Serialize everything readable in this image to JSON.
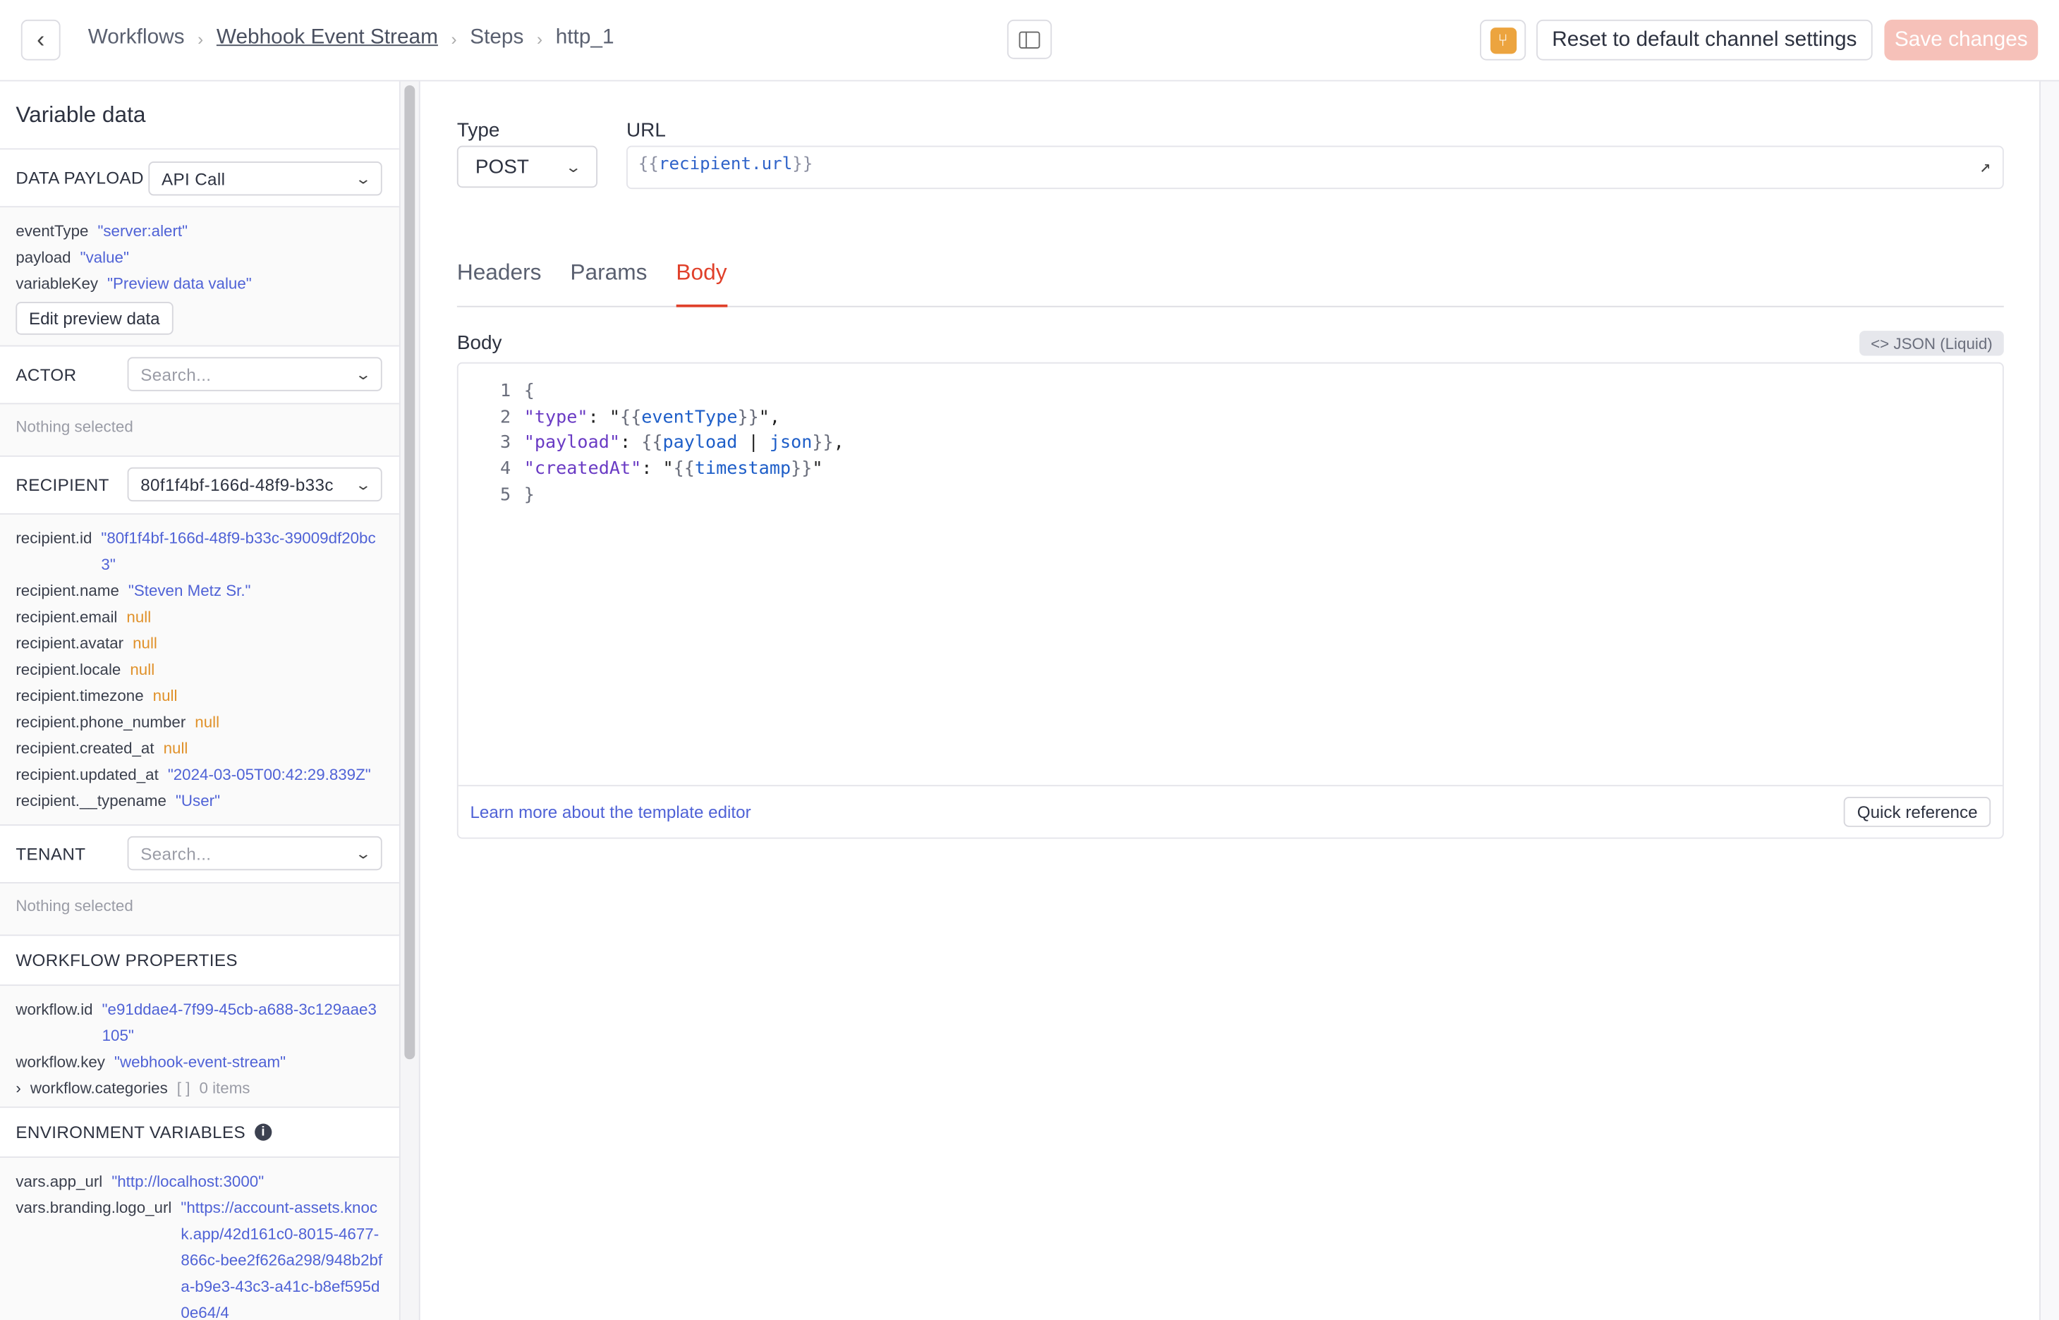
{
  "header": {
    "breadcrumbs": [
      "Workflows",
      "Webhook Event Stream",
      "Steps",
      "http_1"
    ],
    "reset_label": "Reset to default channel settings",
    "save_label": "Save changes",
    "accent": "#e0402a"
  },
  "sidebar": {
    "title": "Variable data",
    "data_payload": {
      "label": "DATA PAYLOAD",
      "value": "API Call",
      "items": [
        {
          "k": "eventType",
          "v": "\"server:alert\""
        },
        {
          "k": "payload",
          "v": "\"value\""
        },
        {
          "k": "variableKey",
          "v": "\"Preview data value\""
        }
      ],
      "edit_label": "Edit preview data"
    },
    "actor": {
      "label": "ACTOR",
      "placeholder": "Search...",
      "empty": "Nothing selected"
    },
    "recipient": {
      "label": "RECIPIENT",
      "value": "80f1f4bf-166d-48f9-b33c",
      "items": [
        {
          "k": "recipient.id",
          "v": "\"80f1f4bf-166d-48f9-b33c-39009df20bc3\""
        },
        {
          "k": "recipient.name",
          "v": "\"Steven Metz Sr.\""
        },
        {
          "k": "recipient.email",
          "v": "null"
        },
        {
          "k": "recipient.avatar",
          "v": "null"
        },
        {
          "k": "recipient.locale",
          "v": "null"
        },
        {
          "k": "recipient.timezone",
          "v": "null"
        },
        {
          "k": "recipient.phone_number",
          "v": "null"
        },
        {
          "k": "recipient.created_at",
          "v": "null"
        },
        {
          "k": "recipient.updated_at",
          "v": "\"2024-03-05T00:42:29.839Z\""
        },
        {
          "k": "recipient.__typename",
          "v": "\"User\""
        }
      ]
    },
    "tenant": {
      "label": "TENANT",
      "placeholder": "Search...",
      "empty": "Nothing selected"
    },
    "workflow": {
      "label": "WORKFLOW PROPERTIES",
      "items": [
        {
          "k": "workflow.id",
          "v": "\"e91ddae4-7f99-45cb-a688-3c129aae3105\""
        },
        {
          "k": "workflow.key",
          "v": "\"webhook-event-stream\""
        }
      ],
      "categories": {
        "k": "workflow.categories",
        "brackets": "[ ]",
        "count": "0 items"
      }
    },
    "env": {
      "label": "ENVIRONMENT VARIABLES",
      "items": [
        {
          "k": "vars.app_url",
          "v": "\"http://localhost:3000\""
        },
        {
          "k": "vars.branding.logo_url",
          "v": "\"https://account-assets.knock.app/42d161c0-8015-4677-866c-bee2f626a298/948b2bfa-b9e3-43c3-a41c-b8ef595d0e64/4"
        }
      ]
    }
  },
  "main": {
    "type_label": "Type",
    "type_value": "POST",
    "url_label": "URL",
    "url_open": "{{",
    "url_var": "recipient.url",
    "url_close": "}}",
    "tabs": [
      "Headers",
      "Params",
      "Body"
    ],
    "active_tab": "Body",
    "body_label": "Body",
    "format_badge": "<> JSON (Liquid)",
    "code": [
      {
        "n": "1",
        "parts": [
          [
            "pb",
            "{"
          ]
        ]
      },
      {
        "n": "2",
        "parts": [
          [
            "pk",
            "\"type\""
          ],
          [
            "pp",
            ": \""
          ],
          [
            "pb",
            "{{"
          ],
          [
            "pv",
            "eventType"
          ],
          [
            "pb",
            "}}"
          ],
          [
            "pp",
            "\","
          ]
        ]
      },
      {
        "n": "3",
        "parts": [
          [
            "pk",
            "\"payload\""
          ],
          [
            "pp",
            ": "
          ],
          [
            "pb",
            "{{"
          ],
          [
            "pv",
            "payload"
          ],
          [
            "pp",
            " | "
          ],
          [
            "pv",
            "json"
          ],
          [
            "pb",
            "}}"
          ],
          [
            "pp",
            ","
          ]
        ]
      },
      {
        "n": "4",
        "parts": [
          [
            "pk",
            "\"createdAt\""
          ],
          [
            "pp",
            ": \""
          ],
          [
            "pb",
            "{{"
          ],
          [
            "pv",
            "timestamp"
          ],
          [
            "pb",
            "}}"
          ],
          [
            "pp",
            "\""
          ]
        ]
      },
      {
        "n": "5",
        "parts": [
          [
            "pb",
            "}"
          ]
        ]
      }
    ],
    "learn_more": "Learn more about the template editor",
    "quick_ref": "Quick reference"
  }
}
